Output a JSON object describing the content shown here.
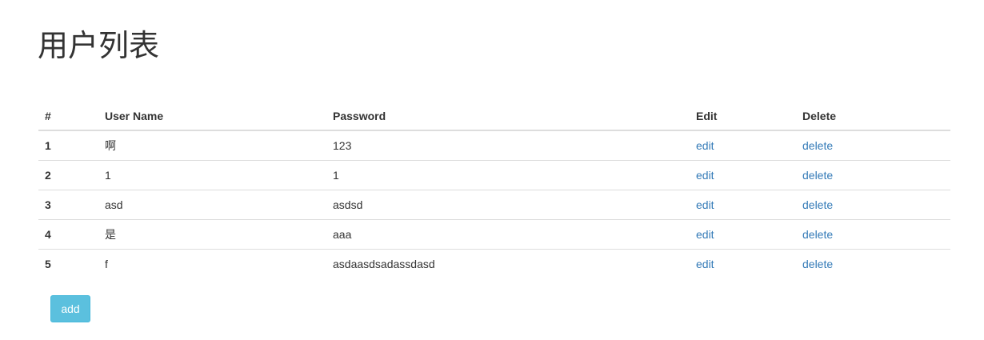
{
  "page": {
    "title": "用户列表"
  },
  "table": {
    "headers": {
      "num": "#",
      "user_name": "User Name",
      "password": "Password",
      "edit": "Edit",
      "delete": "Delete"
    },
    "rows": [
      {
        "num": "1",
        "user_name": "啊",
        "password": "123",
        "edit": "edit",
        "delete": "delete"
      },
      {
        "num": "2",
        "user_name": "1",
        "password": "1",
        "edit": "edit",
        "delete": "delete"
      },
      {
        "num": "3",
        "user_name": "asd",
        "password": "asdsd",
        "edit": "edit",
        "delete": "delete"
      },
      {
        "num": "4",
        "user_name": "是",
        "password": "aaa",
        "edit": "edit",
        "delete": "delete"
      },
      {
        "num": "5",
        "user_name": "f",
        "password": "asdaasdsadassdasd",
        "edit": "edit",
        "delete": "delete"
      }
    ]
  },
  "actions": {
    "add_label": "add"
  },
  "colors": {
    "link": "#337ab7",
    "add_button": "#5bc0de",
    "text": "#333333",
    "border": "#dddddd"
  }
}
